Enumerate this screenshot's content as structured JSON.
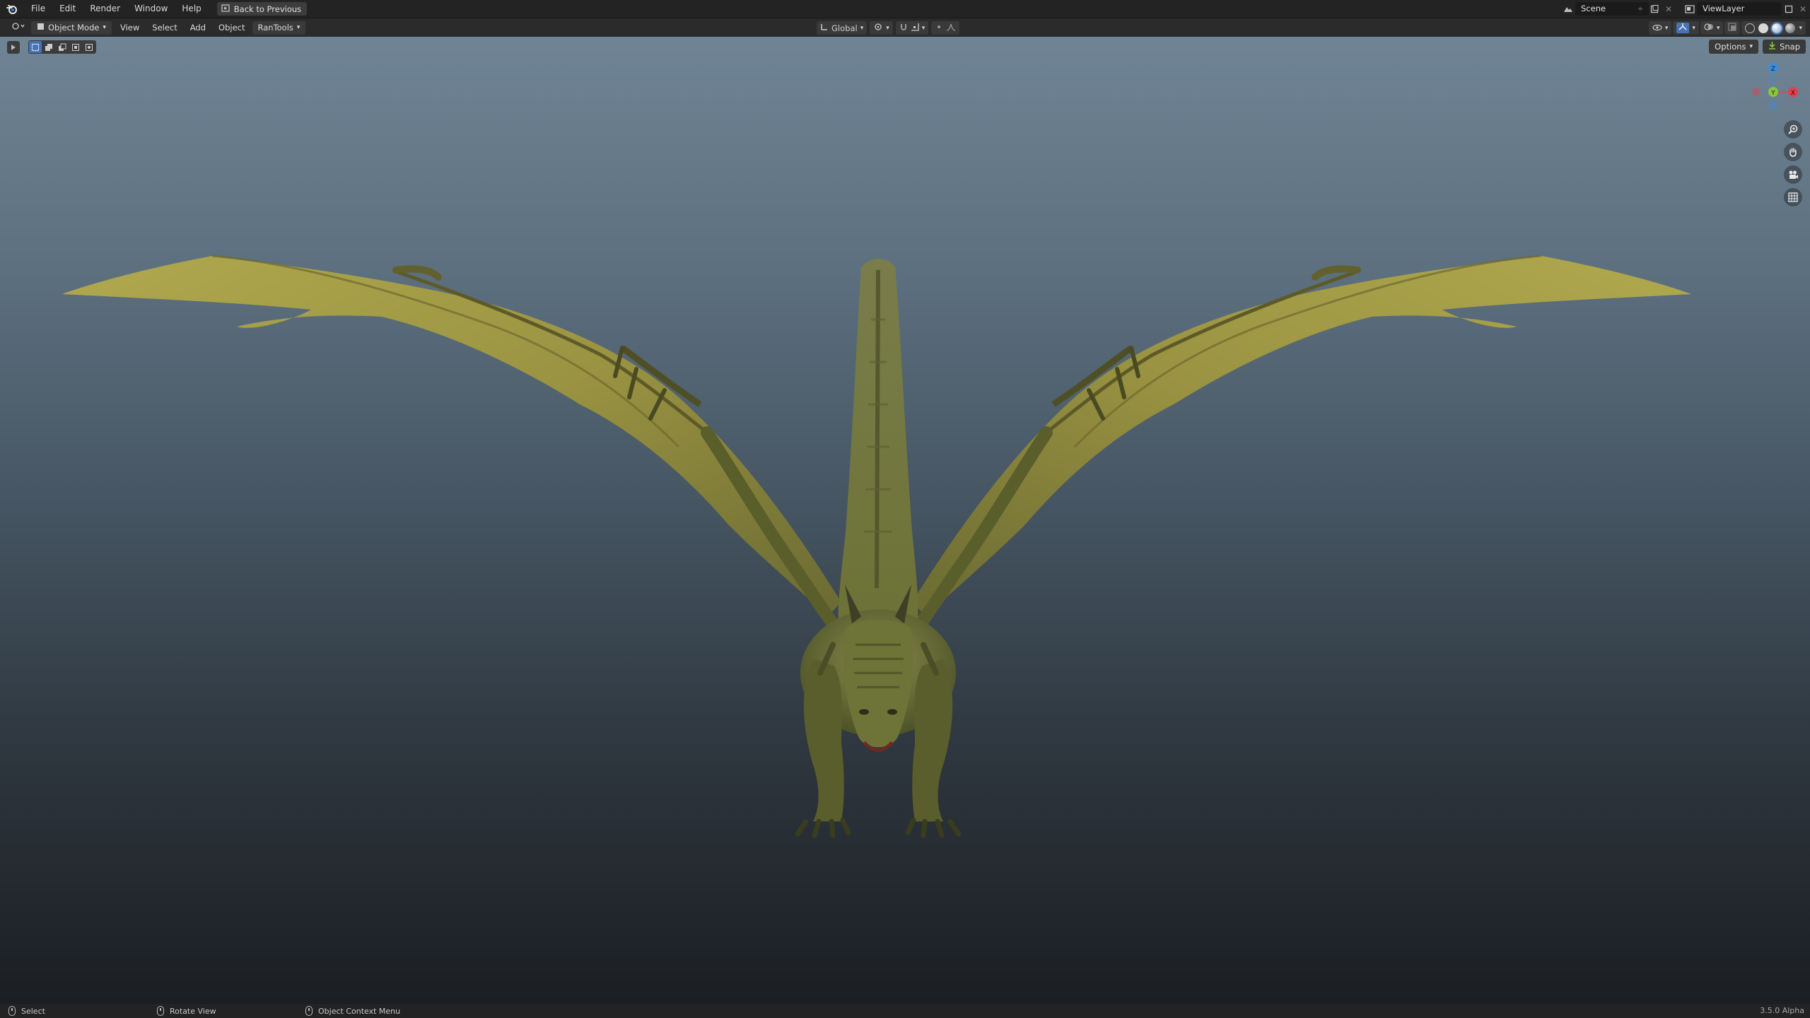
{
  "topbar": {
    "menus": [
      "File",
      "Edit",
      "Render",
      "Window",
      "Help"
    ],
    "back_button": "Back to Previous",
    "scene_name": "Scene",
    "view_layer": "ViewLayer"
  },
  "header": {
    "mode": "Object Mode",
    "menus": [
      "View",
      "Select",
      "Add",
      "Object"
    ],
    "addon_menu": "RanTools",
    "transform_orientation": "Global"
  },
  "viewport": {
    "options_label": "Options",
    "snap_label": "Snap",
    "gizmo_axes": {
      "z": "Z",
      "y": "Y",
      "x": "X"
    }
  },
  "statusbar": {
    "select": "Select",
    "rotate": "Rotate View",
    "context": "Object Context Menu",
    "version": "3.5.0 Alpha"
  },
  "colors": {
    "accent_blue": "#4772b3",
    "axis_x": "#e2404f",
    "axis_y": "#8bc53f",
    "axis_z": "#3f8cd9",
    "dragon_body": "#8f8a3c"
  }
}
